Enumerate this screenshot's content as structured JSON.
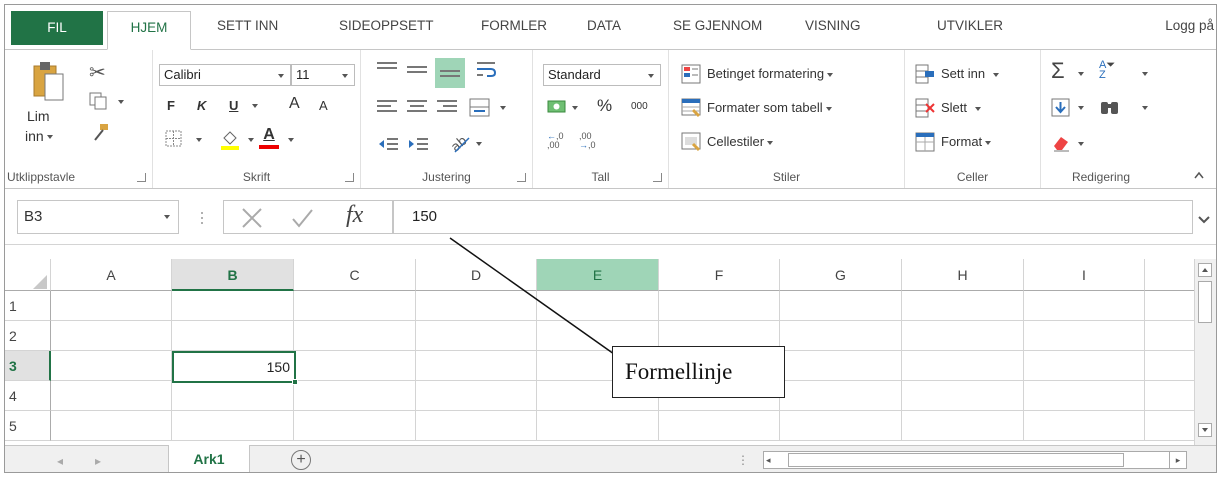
{
  "tabs": {
    "file": "FIL",
    "home": "HJEM",
    "insert": "SETT INN",
    "pagelayout": "SIDEOPPSETT",
    "formulas": "FORMLER",
    "data": "DATA",
    "review": "SE GJENNOM",
    "view": "VISNING",
    "developer": "UTVIKLER",
    "login": "Logg på"
  },
  "ribbon": {
    "clipboard": {
      "paste": "Lim",
      "paste2": "inn",
      "label": "Utklippstavle"
    },
    "font": {
      "name": "Calibri",
      "size": "11",
      "bold": "F",
      "italic": "K",
      "underline": "U",
      "grow": "A",
      "shrink": "A",
      "color_letter": "A",
      "label": "Skrift"
    },
    "alignment": {
      "label": "Justering"
    },
    "number": {
      "format": "Standard",
      "percent": "%",
      "thousands": "000",
      "inc": "+,0\n,00",
      "label": "Tall"
    },
    "styles": {
      "conditional": "Betinget formatering",
      "table": "Formater som tabell",
      "cell": "Cellestiler",
      "label": "Stiler"
    },
    "cells": {
      "insert": "Sett inn",
      "delete": "Slett",
      "format": "Format",
      "label": "Celler"
    },
    "editing": {
      "sum": "Σ",
      "label": "Redigering"
    }
  },
  "formula_bar": {
    "name_box": "B3",
    "fx": "fx",
    "value": "150"
  },
  "grid": {
    "columns": [
      "A",
      "B",
      "C",
      "D",
      "E",
      "F",
      "G",
      "H",
      "I"
    ],
    "rows": [
      "1",
      "2",
      "3",
      "4",
      "5"
    ],
    "cell_b3": "150"
  },
  "sheet": {
    "tab": "Ark1",
    "add": "+"
  },
  "callout": {
    "text": "Formellinje"
  },
  "colors": {
    "accent": "#217346",
    "selected_col": "#9fd5b7"
  }
}
